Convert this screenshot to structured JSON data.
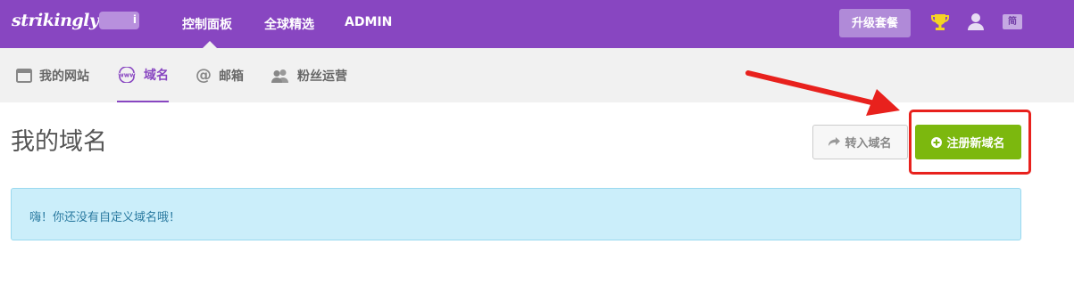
{
  "header": {
    "logo": "strikingly",
    "logo_badge": "i",
    "nav": [
      "控制面板",
      "全球精选",
      "ADMIN"
    ],
    "upgrade_label": "升级套餐",
    "lang_label": "简",
    "brand_color": "#8846c1"
  },
  "subnav": {
    "items": [
      {
        "label": "我的网站",
        "icon": "browser-window-icon"
      },
      {
        "label": "域名",
        "icon": "www-globe-icon",
        "active": true
      },
      {
        "label": "邮箱",
        "icon": "at-icon"
      },
      {
        "label": "粉丝运营",
        "icon": "users-icon"
      }
    ],
    "www_icon_text": "www",
    "at_icon_text": "@"
  },
  "main": {
    "title": "我的域名",
    "transfer_label": "转入域名",
    "register_label": "注册新域名",
    "empty_message": "嗨！你还没有自定义域名哦！"
  },
  "colors": {
    "register_green": "#7cb80e",
    "alert_bg": "#cbeefa",
    "annotation_red": "#e8211d"
  }
}
